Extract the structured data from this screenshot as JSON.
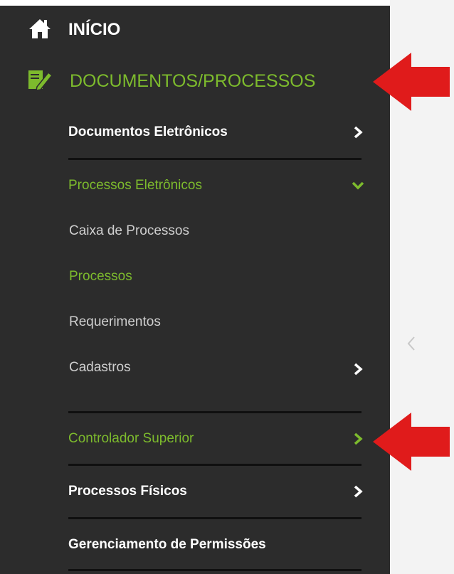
{
  "colors": {
    "sidebar_bg": "#2c2c2c",
    "white_text": "#ffffff",
    "green_text": "#7dbb2d",
    "muted_text": "#cfcfcf",
    "divider": "#101010",
    "arrow_red": "#e01b1b"
  },
  "menu": {
    "inicio": {
      "label": "INÍCIO",
      "icon": "home-icon"
    },
    "documentos_processos": {
      "label": "DOCUMENTOS/PROCESSOS",
      "icon": "document-edit-icon"
    },
    "documentos_eletronicos": {
      "label": "Documentos Eletrônicos",
      "icon": "chevron-right-icon"
    },
    "processos_eletronicos": {
      "label": "Processos Eletrônicos",
      "icon": "chevron-down-icon"
    },
    "caixa_de_processos": {
      "label": "Caixa de Processos"
    },
    "processos": {
      "label": "Processos"
    },
    "requerimentos": {
      "label": "Requerimentos"
    },
    "cadastros": {
      "label": "Cadastros",
      "icon": "chevron-right-icon"
    },
    "controlador_superior": {
      "label": "Controlador Superior",
      "icon": "chevron-right-icon"
    },
    "processos_fisicos": {
      "label": "Processos Físicos",
      "icon": "chevron-right-icon"
    },
    "gerenciamento_permissoes": {
      "label": "Gerenciamento de Permissões"
    }
  },
  "collapse": {
    "icon": "chevron-left-icon"
  },
  "annotations": [
    {
      "icon": "red-arrow-icon"
    },
    {
      "icon": "red-arrow-icon"
    }
  ]
}
